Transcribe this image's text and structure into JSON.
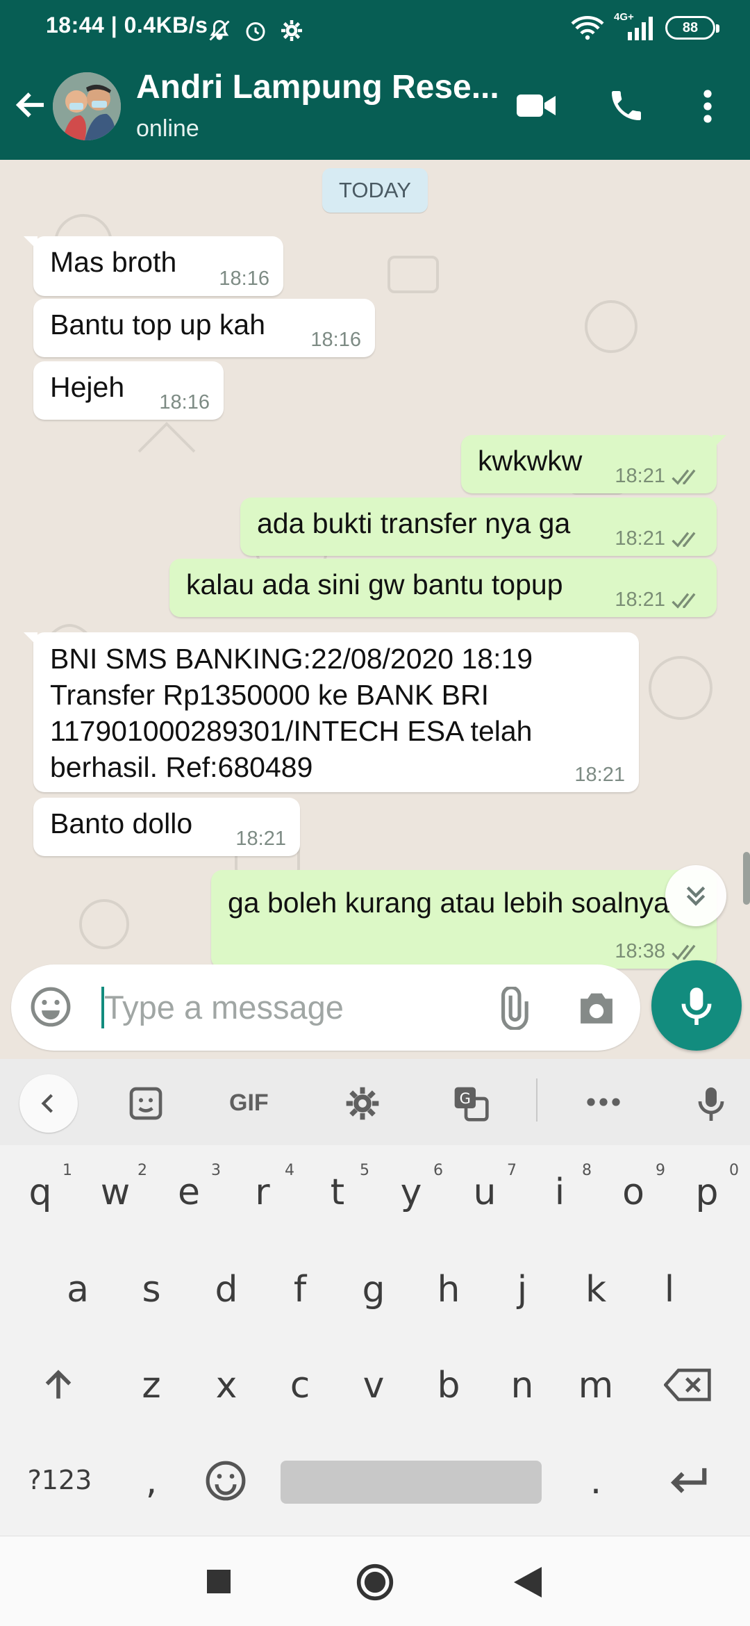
{
  "status_bar": {
    "time_speed": "18:44 | 0.4KB/s",
    "battery": "88",
    "network": "4G+"
  },
  "header": {
    "contact_name": "Andri Lampung Rese...",
    "status": "online"
  },
  "chat": {
    "date_label": "TODAY",
    "messages": [
      {
        "dir": "in",
        "text": "Mas broth",
        "time": "18:16"
      },
      {
        "dir": "in",
        "text": "Bantu top up kah",
        "time": "18:16"
      },
      {
        "dir": "in",
        "text": "Hejeh",
        "time": "18:16"
      },
      {
        "dir": "out",
        "text": "kwkwkw",
        "time": "18:21"
      },
      {
        "dir": "out",
        "text": "ada bukti transfer nya ga",
        "time": "18:21"
      },
      {
        "dir": "out",
        "text": "kalau ada sini gw bantu topup",
        "time": "18:21"
      },
      {
        "dir": "in",
        "text": "BNI SMS BANKING:22/08/2020 18:19 Transfer Rp1350000 ke BANK BRI 117901000289301/INTECH ESA telah berhasil. Ref:680489",
        "time": "18:21"
      },
      {
        "dir": "in",
        "text": "Banto dollo",
        "time": "18:21"
      },
      {
        "dir": "out",
        "text": "ga boleh kurang atau lebih soalnya",
        "time": "18:38"
      }
    ]
  },
  "composer": {
    "placeholder": "Type a message"
  },
  "keyboard": {
    "toolbar_gif": "GIF",
    "row1": [
      "q",
      "w",
      "e",
      "r",
      "t",
      "y",
      "u",
      "i",
      "o",
      "p"
    ],
    "row1_hints": [
      "1",
      "2",
      "3",
      "4",
      "5",
      "6",
      "7",
      "8",
      "9",
      "0"
    ],
    "row2": [
      "a",
      "s",
      "d",
      "f",
      "g",
      "h",
      "j",
      "k",
      "l"
    ],
    "row3": [
      "z",
      "x",
      "c",
      "v",
      "b",
      "n",
      "m"
    ],
    "symbols_key": "?123",
    "comma_key": ",",
    "period_key": "."
  },
  "colors": {
    "header": "#075e54",
    "accent": "#128c7e",
    "outgoing": "#dcf8c6",
    "incoming": "#ffffff",
    "read_check": "#7a8d75"
  }
}
